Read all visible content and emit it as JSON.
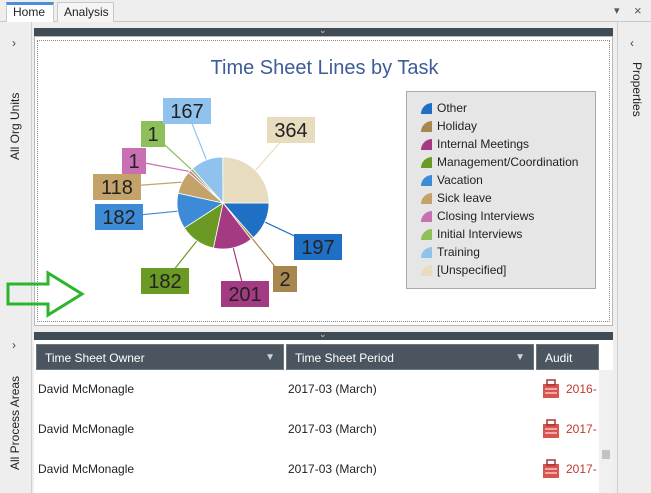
{
  "tabs": [
    {
      "label": "Home",
      "active": true
    },
    {
      "label": "Analysis",
      "active": false
    }
  ],
  "tab_controls": {
    "dropdown": "▾",
    "close": "×"
  },
  "left_rails": [
    {
      "chevron": "›",
      "label": "All Org Units"
    },
    {
      "chevron": "›",
      "label": "All Process Areas"
    }
  ],
  "right_rail": {
    "chevron": "‹",
    "label": "Properties"
  },
  "panel_collapse_glyph": "⌄",
  "chart_data": {
    "type": "pie",
    "title": "Time Sheet Lines by Task",
    "legend_position": "right",
    "slices": [
      {
        "label": "Other",
        "value": 197,
        "color": "#1f6fc5"
      },
      {
        "label": "Holiday",
        "value": 2,
        "color": "#a8864f"
      },
      {
        "label": "Internal Meetings",
        "value": 201,
        "color": "#a33a82"
      },
      {
        "label": "Management/Coordination",
        "value": 182,
        "color": "#6a9a24"
      },
      {
        "label": "Vacation",
        "value": 182,
        "color": "#3d8bd6"
      },
      {
        "label": "Sick leave",
        "value": 118,
        "color": "#c4a36a"
      },
      {
        "label": "Closing Interviews",
        "value": 1,
        "color": "#c96fb4"
      },
      {
        "label": "Initial Interviews",
        "value": 1,
        "color": "#8fbf5a"
      },
      {
        "label": "Training",
        "value": 167,
        "color": "#8fc3ee"
      },
      {
        "label": "[Unspecified]",
        "value": 364,
        "color": "#e8dcbf"
      }
    ]
  },
  "table": {
    "columns": [
      "Time Sheet Owner",
      "Time Sheet Period",
      "Audit"
    ],
    "filter_glyph": "▼",
    "rows": [
      {
        "owner": "David McMonagle",
        "period": "2017-03 (March)",
        "audit": "2016-"
      },
      {
        "owner": "David McMonagle",
        "period": "2017-03 (March)",
        "audit": "2017-"
      },
      {
        "owner": "David McMonagle",
        "period": "2017-03 (March)",
        "audit": "2017-"
      }
    ]
  },
  "colors": {
    "accent": "#4a90d9",
    "header_bg": "#4b5560",
    "arrow": "#2db52d"
  }
}
